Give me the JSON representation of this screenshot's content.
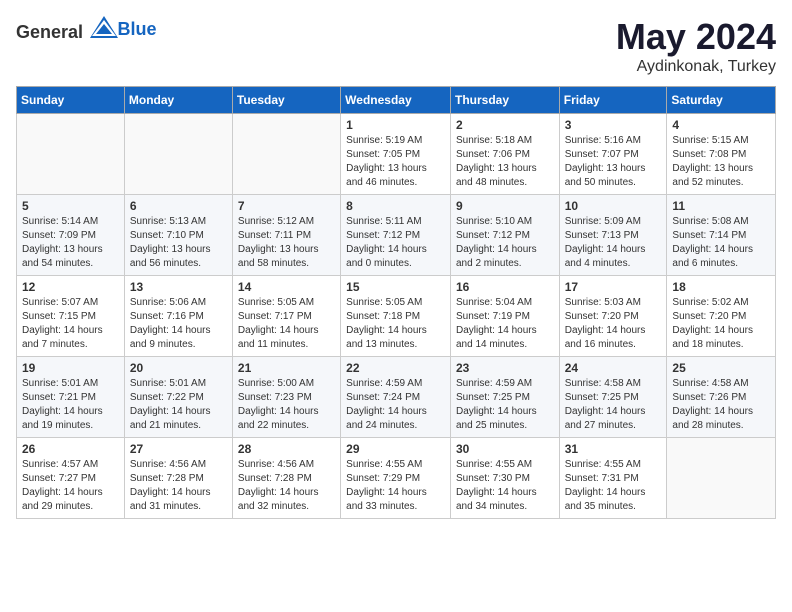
{
  "header": {
    "logo_general": "General",
    "logo_blue": "Blue",
    "month": "May 2024",
    "location": "Aydinkonak, Turkey"
  },
  "weekdays": [
    "Sunday",
    "Monday",
    "Tuesday",
    "Wednesday",
    "Thursday",
    "Friday",
    "Saturday"
  ],
  "weeks": [
    [
      {
        "day": "",
        "info": ""
      },
      {
        "day": "",
        "info": ""
      },
      {
        "day": "",
        "info": ""
      },
      {
        "day": "1",
        "info": "Sunrise: 5:19 AM\nSunset: 7:05 PM\nDaylight: 13 hours\nand 46 minutes."
      },
      {
        "day": "2",
        "info": "Sunrise: 5:18 AM\nSunset: 7:06 PM\nDaylight: 13 hours\nand 48 minutes."
      },
      {
        "day": "3",
        "info": "Sunrise: 5:16 AM\nSunset: 7:07 PM\nDaylight: 13 hours\nand 50 minutes."
      },
      {
        "day": "4",
        "info": "Sunrise: 5:15 AM\nSunset: 7:08 PM\nDaylight: 13 hours\nand 52 minutes."
      }
    ],
    [
      {
        "day": "5",
        "info": "Sunrise: 5:14 AM\nSunset: 7:09 PM\nDaylight: 13 hours\nand 54 minutes."
      },
      {
        "day": "6",
        "info": "Sunrise: 5:13 AM\nSunset: 7:10 PM\nDaylight: 13 hours\nand 56 minutes."
      },
      {
        "day": "7",
        "info": "Sunrise: 5:12 AM\nSunset: 7:11 PM\nDaylight: 13 hours\nand 58 minutes."
      },
      {
        "day": "8",
        "info": "Sunrise: 5:11 AM\nSunset: 7:12 PM\nDaylight: 14 hours\nand 0 minutes."
      },
      {
        "day": "9",
        "info": "Sunrise: 5:10 AM\nSunset: 7:12 PM\nDaylight: 14 hours\nand 2 minutes."
      },
      {
        "day": "10",
        "info": "Sunrise: 5:09 AM\nSunset: 7:13 PM\nDaylight: 14 hours\nand 4 minutes."
      },
      {
        "day": "11",
        "info": "Sunrise: 5:08 AM\nSunset: 7:14 PM\nDaylight: 14 hours\nand 6 minutes."
      }
    ],
    [
      {
        "day": "12",
        "info": "Sunrise: 5:07 AM\nSunset: 7:15 PM\nDaylight: 14 hours\nand 7 minutes."
      },
      {
        "day": "13",
        "info": "Sunrise: 5:06 AM\nSunset: 7:16 PM\nDaylight: 14 hours\nand 9 minutes."
      },
      {
        "day": "14",
        "info": "Sunrise: 5:05 AM\nSunset: 7:17 PM\nDaylight: 14 hours\nand 11 minutes."
      },
      {
        "day": "15",
        "info": "Sunrise: 5:05 AM\nSunset: 7:18 PM\nDaylight: 14 hours\nand 13 minutes."
      },
      {
        "day": "16",
        "info": "Sunrise: 5:04 AM\nSunset: 7:19 PM\nDaylight: 14 hours\nand 14 minutes."
      },
      {
        "day": "17",
        "info": "Sunrise: 5:03 AM\nSunset: 7:20 PM\nDaylight: 14 hours\nand 16 minutes."
      },
      {
        "day": "18",
        "info": "Sunrise: 5:02 AM\nSunset: 7:20 PM\nDaylight: 14 hours\nand 18 minutes."
      }
    ],
    [
      {
        "day": "19",
        "info": "Sunrise: 5:01 AM\nSunset: 7:21 PM\nDaylight: 14 hours\nand 19 minutes."
      },
      {
        "day": "20",
        "info": "Sunrise: 5:01 AM\nSunset: 7:22 PM\nDaylight: 14 hours\nand 21 minutes."
      },
      {
        "day": "21",
        "info": "Sunrise: 5:00 AM\nSunset: 7:23 PM\nDaylight: 14 hours\nand 22 minutes."
      },
      {
        "day": "22",
        "info": "Sunrise: 4:59 AM\nSunset: 7:24 PM\nDaylight: 14 hours\nand 24 minutes."
      },
      {
        "day": "23",
        "info": "Sunrise: 4:59 AM\nSunset: 7:25 PM\nDaylight: 14 hours\nand 25 minutes."
      },
      {
        "day": "24",
        "info": "Sunrise: 4:58 AM\nSunset: 7:25 PM\nDaylight: 14 hours\nand 27 minutes."
      },
      {
        "day": "25",
        "info": "Sunrise: 4:58 AM\nSunset: 7:26 PM\nDaylight: 14 hours\nand 28 minutes."
      }
    ],
    [
      {
        "day": "26",
        "info": "Sunrise: 4:57 AM\nSunset: 7:27 PM\nDaylight: 14 hours\nand 29 minutes."
      },
      {
        "day": "27",
        "info": "Sunrise: 4:56 AM\nSunset: 7:28 PM\nDaylight: 14 hours\nand 31 minutes."
      },
      {
        "day": "28",
        "info": "Sunrise: 4:56 AM\nSunset: 7:28 PM\nDaylight: 14 hours\nand 32 minutes."
      },
      {
        "day": "29",
        "info": "Sunrise: 4:55 AM\nSunset: 7:29 PM\nDaylight: 14 hours\nand 33 minutes."
      },
      {
        "day": "30",
        "info": "Sunrise: 4:55 AM\nSunset: 7:30 PM\nDaylight: 14 hours\nand 34 minutes."
      },
      {
        "day": "31",
        "info": "Sunrise: 4:55 AM\nSunset: 7:31 PM\nDaylight: 14 hours\nand 35 minutes."
      },
      {
        "day": "",
        "info": ""
      }
    ]
  ]
}
